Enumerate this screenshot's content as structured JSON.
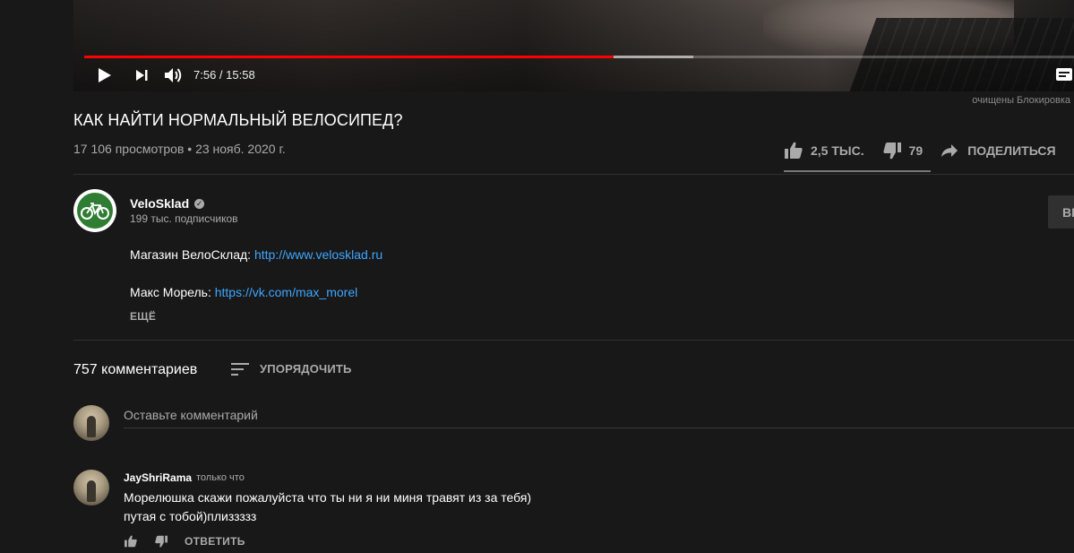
{
  "player": {
    "time": "7:56 / 15:58",
    "progress_played": 0.535,
    "progress_buffered": 0.615,
    "blocker_note": "очищены Блокировка"
  },
  "video": {
    "title": "КАК НАЙТИ НОРМАЛЬНЫЙ ВЕЛОСИПЕД?",
    "meta": "17 106 просмотров • 23 нояб. 2020 г.",
    "likes": "2,5 ТЫС.",
    "dislikes": "79",
    "share_label": "ПОДЕЛИТЬСЯ"
  },
  "channel": {
    "name": "VeloSklad",
    "subscribers": "199 тыс. подписчиков",
    "subscribe_label": "ВЫ",
    "desc_shop_label": "Магазин ВелоСклад: ",
    "desc_shop_link": "http://www.velosklad.ru",
    "desc_author_label": "Макс Морель: ",
    "desc_author_link": "https://vk.com/max_morel",
    "more_label": "ЕЩЁ"
  },
  "comments": {
    "count": "757 комментариев",
    "sort_label": "УПОРЯДОЧИТЬ",
    "input_placeholder": "Оставьте комментарий",
    "items": [
      {
        "author": "JayShriRama",
        "time": "только что",
        "line1": "Морелюшка скажи пожалуйста что ты ни я ни миня травят из за тебя)",
        "line2": "путая с тобой)плиззззз",
        "reply_label": "ОТВЕТИТЬ"
      }
    ]
  },
  "colors": {
    "background": "#181818",
    "progress_red": "#ff0000",
    "link_blue": "#3ea6ff",
    "muted_text": "#aaaaaa"
  }
}
